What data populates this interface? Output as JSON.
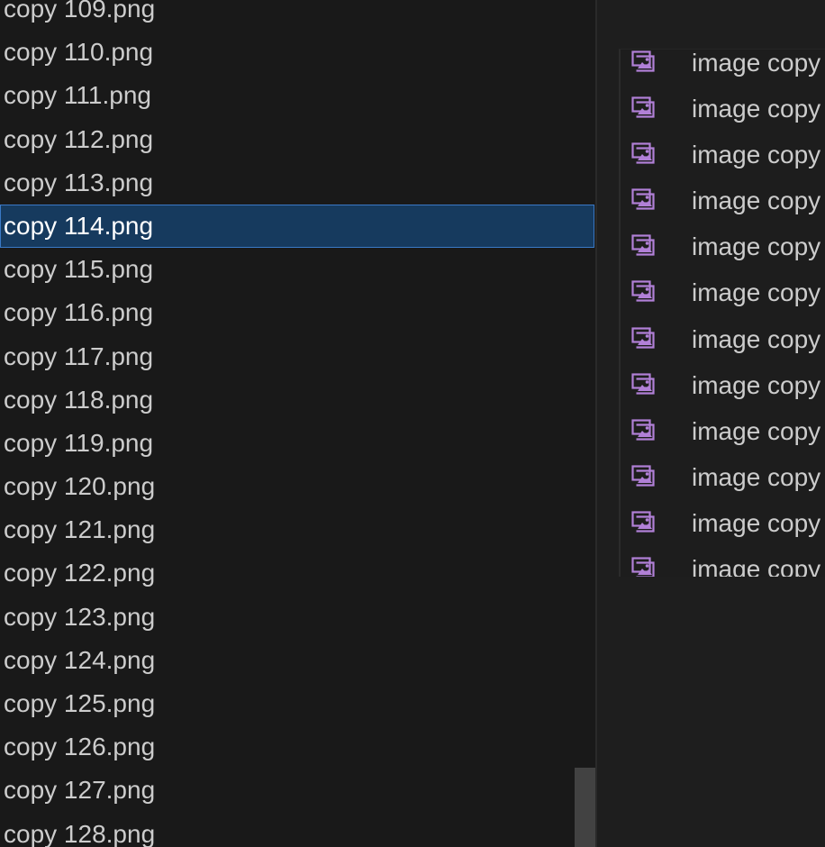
{
  "left_panel": {
    "files": [
      {
        "label": "copy 109.png",
        "selected": false
      },
      {
        "label": "copy 110.png",
        "selected": false
      },
      {
        "label": "copy 111.png",
        "selected": false
      },
      {
        "label": "copy 112.png",
        "selected": false
      },
      {
        "label": "copy 113.png",
        "selected": false
      },
      {
        "label": "copy 114.png",
        "selected": true
      },
      {
        "label": "copy 115.png",
        "selected": false
      },
      {
        "label": "copy 116.png",
        "selected": false
      },
      {
        "label": "copy 117.png",
        "selected": false
      },
      {
        "label": "copy 118.png",
        "selected": false
      },
      {
        "label": "copy 119.png",
        "selected": false
      },
      {
        "label": "copy 120.png",
        "selected": false
      },
      {
        "label": "copy 121.png",
        "selected": false
      },
      {
        "label": "copy 122.png",
        "selected": false
      },
      {
        "label": "copy 123.png",
        "selected": false
      },
      {
        "label": "copy 124.png",
        "selected": false
      },
      {
        "label": "copy 125.png",
        "selected": false
      },
      {
        "label": "copy 126.png",
        "selected": false
      },
      {
        "label": "copy 127.png",
        "selected": false
      },
      {
        "label": "copy 128.png",
        "selected": false
      }
    ]
  },
  "drag_preview": {
    "icon": "image-file-icon",
    "icon_color": "#b180d7",
    "items": [
      "image copy",
      "image copy",
      "image copy",
      "image copy",
      "image copy",
      "image copy",
      "image copy",
      "image copy",
      "image copy",
      "image copy",
      "image copy",
      "image copy"
    ]
  },
  "colors": {
    "selection_bg": "#163a5e",
    "selection_border": "#3a79c6",
    "text": "#cccccc",
    "panel_bg": "#191919"
  }
}
